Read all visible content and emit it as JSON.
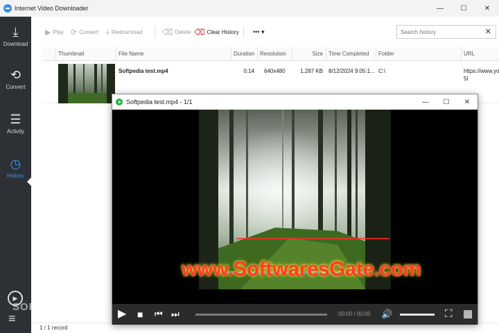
{
  "window": {
    "title": "Internet Video Downloader",
    "controls": {
      "minimize": "—",
      "maximize": "☐",
      "close": "✕"
    }
  },
  "sidebar": {
    "items": [
      {
        "label": "Download",
        "icon": "download-icon",
        "glyph": "⤓"
      },
      {
        "label": "Convert",
        "icon": "convert-icon",
        "glyph": "⟲"
      },
      {
        "label": "Activity",
        "icon": "activity-icon",
        "glyph": "☰"
      },
      {
        "label": "History",
        "icon": "history-icon",
        "glyph": "◷",
        "active": true
      }
    ],
    "play_glyph": "▶",
    "menu_glyph": "≡"
  },
  "toolbar": {
    "play_label": "Play",
    "convert_label": "Convert",
    "redownload_label": "Redownload",
    "delete_label": "Delete",
    "clear_history_label": "Clear History",
    "more_glyph": "••• ▾",
    "play_glyph": "▶",
    "convert_glyph": "⟳",
    "redownload_glyph": "⤓",
    "delete_glyph": "⌫",
    "clear_glyph": "⌫"
  },
  "search": {
    "placeholder": "Search history",
    "clear_glyph": "✕"
  },
  "table": {
    "columns": [
      "Thumbnail",
      "File Name",
      "Duration",
      "Resolution",
      "Size",
      "Time Completed",
      "Folder",
      "URL"
    ],
    "rows": [
      {
        "file_name": "Softpedia test.mp4",
        "duration": "0:14",
        "resolution": "640x480",
        "size": "1,287 KB",
        "time_completed": "8/12/2024 9:05:1...",
        "folder": "C:\\",
        "url": "https://www.yo",
        "url_line2": "5I"
      }
    ]
  },
  "statusbar": {
    "records": "1 / 1 record"
  },
  "watermarks": {
    "softpedia": "SOFTPEDIA",
    "gate": "www.SoftwaresGate.com"
  },
  "player": {
    "title": "Softpedia test.mp4 - 1/1",
    "controls": {
      "minimize": "—",
      "maximize": "☐",
      "close": "✕"
    },
    "time": "00:00 / 00:00",
    "glyphs": {
      "play": "▶",
      "stop": "■",
      "prev": "⏮",
      "next": "⏭",
      "volume": "🔊",
      "fullscreen": "⛶",
      "grid": "▦"
    }
  },
  "colors": {
    "sidebar": "#2d3035",
    "accent": "#2e9bff",
    "clear_history": "#d9272e",
    "player_bar": "#2b2b2b"
  }
}
